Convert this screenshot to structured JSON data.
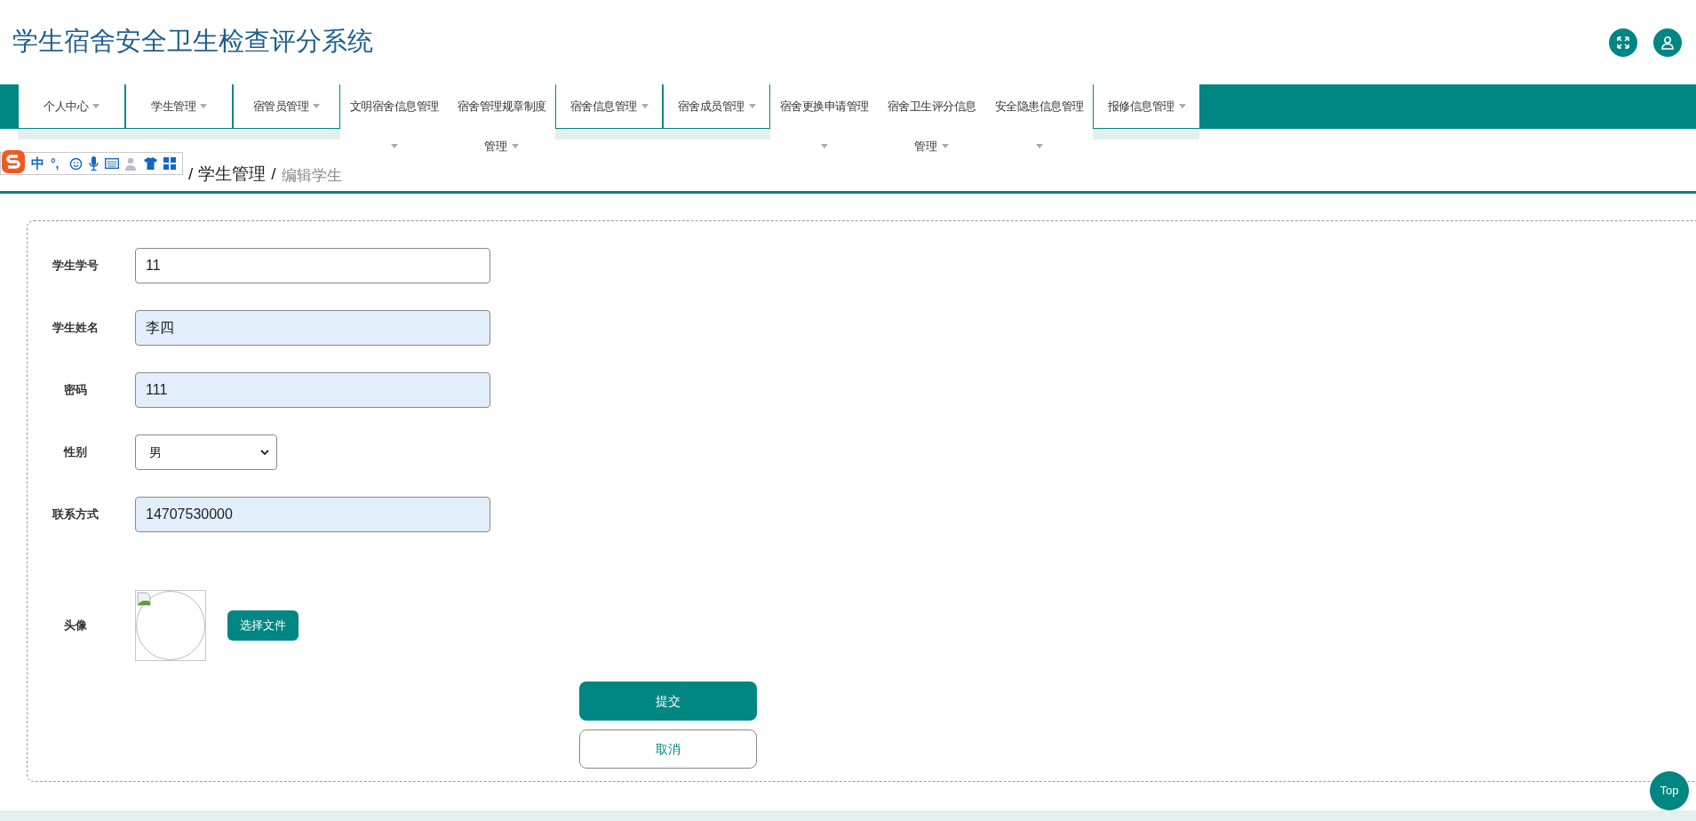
{
  "header": {
    "title": "学生宿舍安全卫生检查评分系统"
  },
  "nav": [
    {
      "kind": "tab",
      "label": "个人中心"
    },
    {
      "kind": "tab",
      "label": "学生管理"
    },
    {
      "kind": "tab",
      "label": "宿管员管理"
    },
    {
      "kind": "wrapped",
      "label": "文明宿舍信息管理"
    },
    {
      "kind": "wrapped",
      "label": "宿舍管理规章制度",
      "line2": "管理"
    },
    {
      "kind": "tab",
      "label": "宿舍信息管理"
    },
    {
      "kind": "tab",
      "label": "宿舍成员管理"
    },
    {
      "kind": "wrapped",
      "label": "宿舍更换申请管理"
    },
    {
      "kind": "wrapped",
      "label": "宿舍卫生评分信息",
      "line2": "管理"
    },
    {
      "kind": "wrapped",
      "label": "安全隐患信息管理"
    },
    {
      "kind": "tab",
      "label": "报修信息管理"
    }
  ],
  "ime_toolbar": {
    "mode": "中",
    "punctuation": "°,"
  },
  "breadcrumb": [
    {
      "separator": "/",
      "label": "学生管理",
      "current": false
    },
    {
      "separator": "/",
      "label": "编辑学生",
      "current": true
    }
  ],
  "form": {
    "fields": [
      {
        "kind": "input",
        "label": "学生学号",
        "value": "11",
        "autofilled": false
      },
      {
        "kind": "input",
        "label": "学生姓名",
        "value": "李四",
        "autofilled": true
      },
      {
        "kind": "input",
        "label": "密码",
        "value": "111",
        "autofilled": true
      },
      {
        "kind": "select",
        "label": "性别",
        "value": "男",
        "autofilled": false
      },
      {
        "kind": "input",
        "label": "联系方式",
        "value": "14707530000",
        "autofilled": true
      },
      {
        "kind": "avatar",
        "label": "头像",
        "button": "选择文件"
      }
    ],
    "submit": "提交",
    "cancel": "取消"
  },
  "back_to_top": "Top"
}
